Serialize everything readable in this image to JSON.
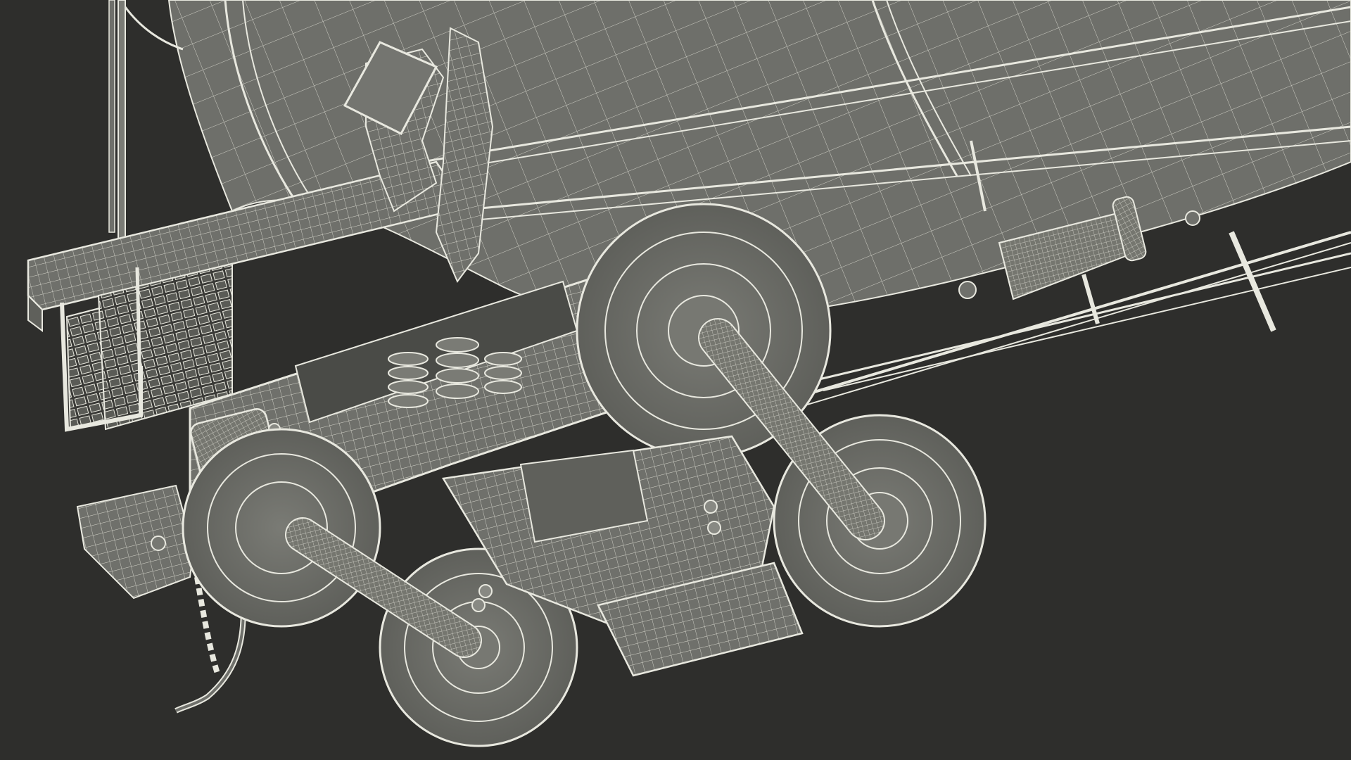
{
  "scene": {
    "background_color": "#2e2e2c",
    "mesh_color": "#6f706b",
    "mesh_light": "#8a8b85",
    "wire_color": "#e8e8df"
  }
}
